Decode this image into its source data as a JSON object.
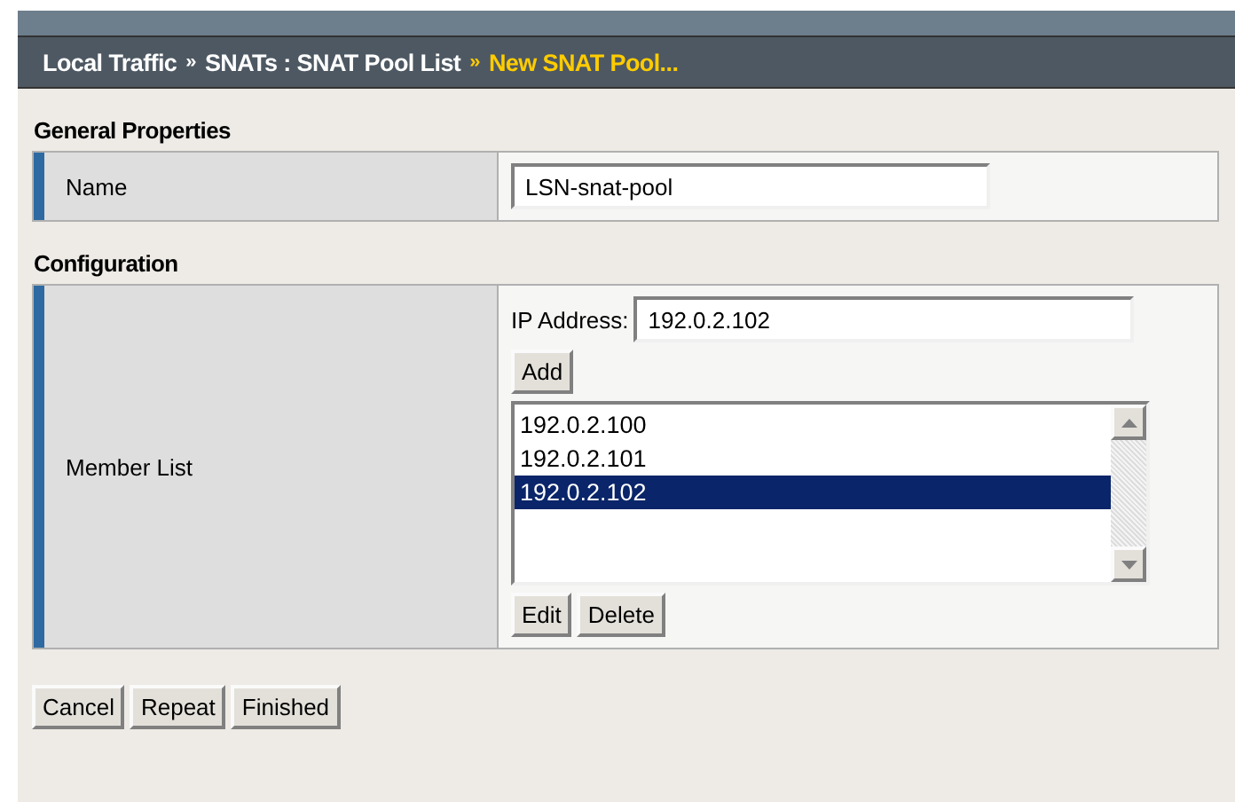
{
  "breadcrumb": {
    "items": [
      "Local Traffic",
      "SNATs : SNAT Pool List"
    ],
    "separators": [
      "»",
      "»"
    ],
    "current": "New SNAT Pool..."
  },
  "sections": [
    {
      "title": "General Properties",
      "rows": [
        {
          "kind": "text",
          "label": "Name",
          "value": "LSN-snat-pool"
        }
      ]
    },
    {
      "title": "Configuration",
      "rows": [
        {
          "kind": "members",
          "label": "Member List",
          "field_label": "IP Address:",
          "value": "192.0.2.102",
          "add_button": "Add",
          "members": [
            {
              "label": "192.0.2.100",
              "selected": false
            },
            {
              "label": "192.0.2.101",
              "selected": false
            },
            {
              "label": "192.0.2.102",
              "selected": true
            }
          ],
          "list_buttons": [
            "Edit",
            "Delete"
          ]
        }
      ]
    }
  ],
  "buttons": [
    "Cancel",
    "Repeat",
    "Finished"
  ]
}
